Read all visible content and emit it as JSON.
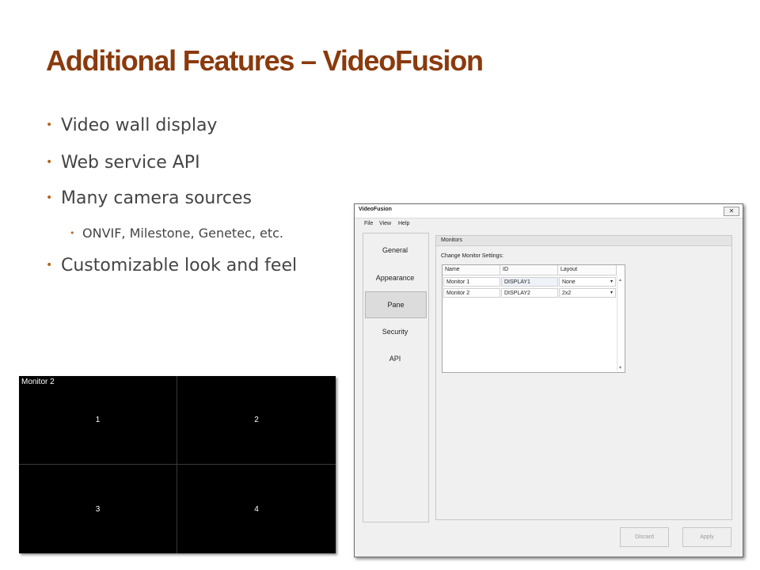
{
  "slide": {
    "title": "Additional Features – VideoFusion",
    "bullets": [
      {
        "text": "Video wall display",
        "level": 1
      },
      {
        "text": "Web service API",
        "level": 1
      },
      {
        "text": "Many camera sources",
        "level": 1
      },
      {
        "text": "ONVIF, Milestone, Genetec, etc.",
        "level": 2
      },
      {
        "text": "Customizable look and feel",
        "level": 1
      }
    ],
    "bullet_glyph": "•"
  },
  "monitor_preview": {
    "label": "Monitor 2",
    "cells": [
      "1",
      "2",
      "3",
      "4"
    ]
  },
  "app": {
    "title": "VideoFusion",
    "close_glyph": "✕",
    "menu": [
      "File",
      "View",
      "Help"
    ],
    "nav": [
      "General",
      "Appearance",
      "Pane",
      "Security",
      "API"
    ],
    "selected_nav": "Pane",
    "section_title": "Monitors",
    "section_label": "Change Monitor Settings:",
    "table": {
      "columns": [
        "Name",
        "ID",
        "Layout"
      ],
      "rows": [
        {
          "name": "Monitor 1",
          "id": "DISPLAY1",
          "layout": "None"
        },
        {
          "name": "Monitor 2",
          "id": "DISPLAY2",
          "layout": "2x2"
        }
      ]
    },
    "dropdown_arrow": "▾",
    "scroll_up": "▴",
    "scroll_down": "▾",
    "buttons": {
      "discard": "Discard",
      "apply": "Apply"
    }
  }
}
